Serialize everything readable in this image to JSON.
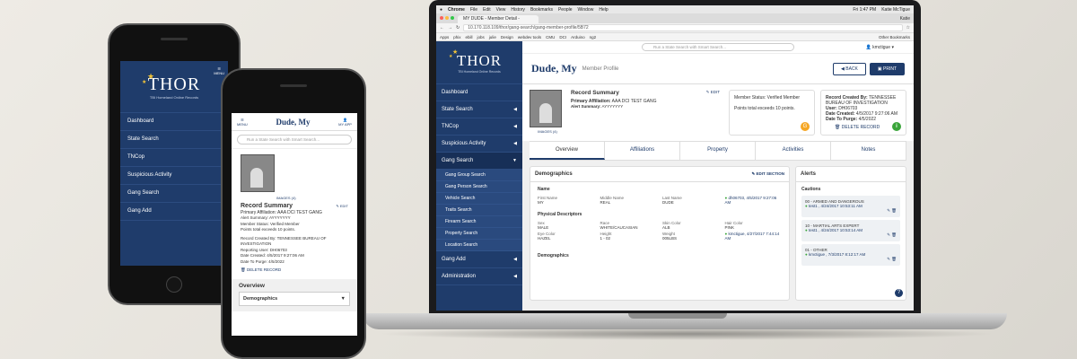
{
  "mac": {
    "menu": [
      "Chrome",
      "File",
      "Edit",
      "View",
      "History",
      "Bookmarks",
      "People",
      "Window",
      "Help"
    ],
    "clock": "Fri 1:47 PM",
    "user": "Katie McTigue"
  },
  "browser": {
    "tab_title": "MY DUDE - Member Detail -",
    "profile_name": "Katie",
    "url": "10.170.118.109/thor/gang-search/gang-member-profile/5B72",
    "bookmarks": [
      "Apps",
      "phix",
      "ebill",
      "jobs",
      "julie",
      "Design",
      "webdev tools",
      "CMU",
      "DCI",
      "Arduino",
      "ng2"
    ],
    "other_bookmarks": "Other Bookmarks"
  },
  "app": {
    "logo": "THOR",
    "logo_sub": "TBI Homeland Online Records",
    "search_placeholder": "Run a State Search with Smart Search...",
    "username": "kmctigue",
    "nav": [
      {
        "label": "Dashboard",
        "arrow": ""
      },
      {
        "label": "State Search",
        "arrow": "◀"
      },
      {
        "label": "TNCop",
        "arrow": "◀"
      },
      {
        "label": "Suspicious Activity",
        "arrow": "◀"
      },
      {
        "label": "Gang Search",
        "arrow": "▼"
      }
    ],
    "subnav": [
      "Gang Group Search",
      "Gang Person Search",
      "Vehicle Search",
      "Traits Search",
      "Firearm Search",
      "Property Search",
      "Location Search"
    ],
    "nav_after": [
      {
        "label": "Gang Add",
        "arrow": "◀"
      },
      {
        "label": "Administration",
        "arrow": "◀"
      }
    ],
    "page": {
      "name": "Dude, My",
      "subtitle": "Member Profile",
      "back": "BACK",
      "print": "PRINT"
    },
    "summary": {
      "title": "Record Summary",
      "edit": "EDIT",
      "images": "IMAGES (4)",
      "affil_label": "Primary Affiliation:",
      "affil": "AAA DCI TEST GANG",
      "alert_label": "Alert Summary:",
      "alert": "AYYYYYYY",
      "status": "Member Status: Verified Member",
      "points": "Points total exceeds 10 points.",
      "badge": "G",
      "created_by_label": "Record Created By:",
      "created_by": "TENNESSEE BUREAU OF INVESTIGATION",
      "user_label": "User:",
      "user": "DH06703",
      "date_created_label": "Date Created:",
      "date_created": "4/5/2017 9:27:06 AM",
      "purge_label": "Date To Purge:",
      "purge": "4/5/2022",
      "delete": "DELETE RECORD",
      "info_badge": "i"
    },
    "tabs": [
      "Overview",
      "Affiliations",
      "Property",
      "Activities",
      "Notes"
    ],
    "demographics": {
      "title": "Demographics",
      "edit": "EDIT SECTION",
      "name_head": "Name",
      "name_fields": [
        [
          "First Name",
          "MY"
        ],
        [
          "Middle Name",
          "REAL"
        ],
        [
          "Last Name",
          "DUDE"
        ],
        [
          "",
          "dh06703, 4/5/2017 9:27:06 AM"
        ]
      ],
      "phys_head": "Physical Descriptors",
      "phys_fields": [
        [
          "Sex",
          "MALE"
        ],
        [
          "Race",
          "WHITE/CAUCASIAN"
        ],
        [
          "Skin Color",
          "ALB"
        ],
        [
          "Hair Color",
          "PINK"
        ],
        [
          "Eye Color",
          "HAZEL"
        ],
        [
          "Height",
          "1 - 02"
        ],
        [
          "Weight",
          "005LBS"
        ],
        [
          "",
          "kmctigue, 4/27/2017 7:44:14 AM"
        ]
      ],
      "more": "Demographics"
    },
    "alerts": {
      "title": "Alerts",
      "cautions": "Cautions",
      "items": [
        {
          "title": "00 - ARMED AND DANGEROUS",
          "by": "test1 , 4/24/2017 10:53:11 AM"
        },
        {
          "title": "10 - MARTIAL ARTS EXPERT",
          "by": "test1 , 4/24/2017 10:53:14 AM"
        },
        {
          "title": "01 - OTHER",
          "by": "kmctigue , 7/3/2017 8:12:17 AM"
        }
      ]
    }
  },
  "phone_back": {
    "logo": "THOR",
    "logo_sub": "TBI Homeland Online Records",
    "menu": "MENU",
    "nav": [
      "Dashboard",
      "State Search",
      "TNCop",
      "Suspicious Activity",
      "Gang Search",
      "Gang Add"
    ]
  },
  "phone_front": {
    "menu": "MENU",
    "title": "Dude, My",
    "myapp": "MY APP",
    "search_placeholder": "Run a State Search with Smart Search...",
    "images": "IMAGES (4)",
    "summary_title": "Record Summary",
    "edit": "EDIT",
    "affil": "Primary Affiliation: AAA DCI TEST GANG",
    "alert": "Alert Summary: AYYYYYYY",
    "status": "Member Status: Verified Member",
    "points": "Points total exceeds 10 points.",
    "created": "Record Created By: TENNESSEE BUREAU OF INVESTIGATION",
    "user": "Reporting User: DH06703",
    "date": "Date Created: 4/5/2017 9:27:06 AM",
    "purge": "Date To Purge: 4/5/2022",
    "delete": "DELETE RECORD",
    "overview": "Overview",
    "demo": "Demographics"
  }
}
